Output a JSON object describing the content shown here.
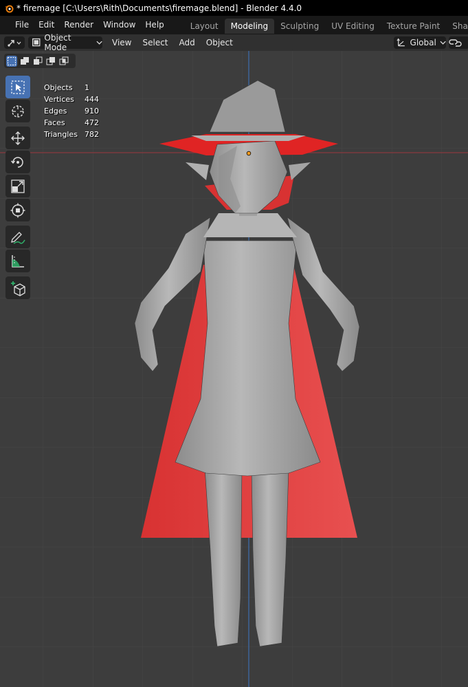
{
  "window": {
    "title": "* firemage [C:\\Users\\Rith\\Documents\\firemage.blend] - Blender 4.4.0"
  },
  "menu": {
    "items": [
      "File",
      "Edit",
      "Render",
      "Window",
      "Help"
    ]
  },
  "workspaces": {
    "tabs": [
      "Layout",
      "Modeling",
      "Sculpting",
      "UV Editing",
      "Texture Paint",
      "Shading"
    ],
    "active_index": 1
  },
  "header": {
    "mode": "Object Mode",
    "menus": [
      "View",
      "Select",
      "Add",
      "Object"
    ],
    "orientation": "Global"
  },
  "stats": {
    "rows": [
      {
        "label": "Objects",
        "value": "1"
      },
      {
        "label": "Vertices",
        "value": "444"
      },
      {
        "label": "Edges",
        "value": "910"
      },
      {
        "label": "Faces",
        "value": "472"
      },
      {
        "label": "Triangles",
        "value": "782"
      }
    ]
  },
  "colors": {
    "accent": "#4772b3",
    "grid_bg": "#3d3d3d",
    "cape": "#e23b3b",
    "mesh": "#a6a6a6",
    "axis_x": "#8a3a3f",
    "axis_y": "#3e6fb0",
    "origin": "#ff9d1f"
  },
  "toolbar": {
    "tools": [
      "select-box-icon",
      "cursor-icon",
      "move-icon",
      "rotate-icon",
      "scale-icon",
      "transform-icon",
      "annotate-icon",
      "measure-icon",
      "add-cube-icon"
    ],
    "active_index": 0
  }
}
